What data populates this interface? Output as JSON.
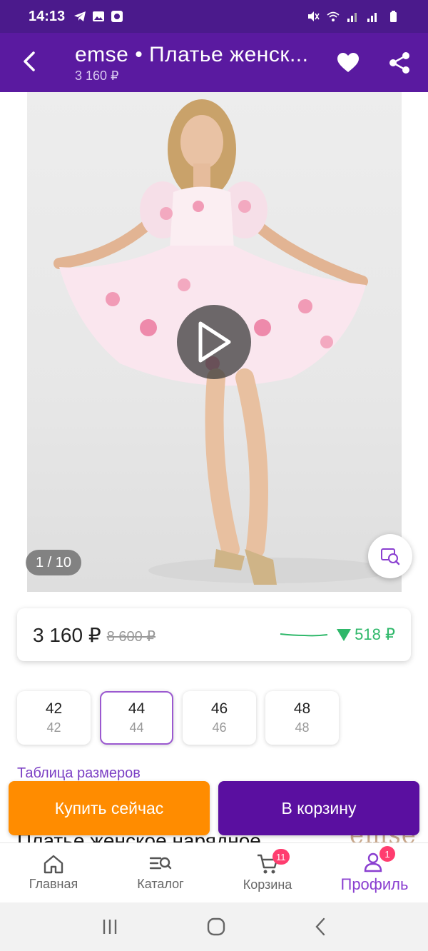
{
  "status_bar": {
    "time": "14:13"
  },
  "app_bar": {
    "title": "emse • Платье женск...",
    "subtitle": "3 160 ₽"
  },
  "gallery": {
    "counter": "1 / 10"
  },
  "price_card": {
    "price": "3 160 ₽",
    "old_price": "8 600 ₽",
    "drop": "518 ₽"
  },
  "sizes": [
    {
      "main": "42",
      "sub": "42"
    },
    {
      "main": "44",
      "sub": "44"
    },
    {
      "main": "46",
      "sub": "46"
    },
    {
      "main": "48",
      "sub": "48"
    }
  ],
  "size_table_link": "Таблица размеров",
  "product_title_peek": "Платье женское нарядное",
  "brand_logo": "emse",
  "actions": {
    "buy_now": "Купить сейчас",
    "to_cart": "В корзину"
  },
  "bottom_nav": [
    {
      "label": "Главная",
      "icon": "home-icon"
    },
    {
      "label": "Каталог",
      "icon": "catalog-search-icon"
    },
    {
      "label": "Корзина",
      "icon": "cart-icon",
      "badge": "11"
    },
    {
      "label": "Профиль",
      "icon": "profile-icon",
      "badge": "1"
    }
  ],
  "colors": {
    "brand_purple": "#5a1aa0",
    "buy_orange": "#ff8c00",
    "price_drop_green": "#2fb86a"
  }
}
